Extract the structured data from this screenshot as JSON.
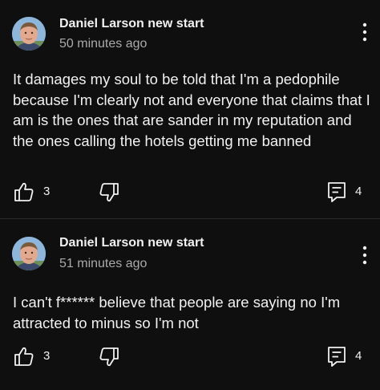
{
  "comments": [
    {
      "author": "Daniel Larson new start",
      "time": "50 minutes ago",
      "text": "It damages my soul to be told that I'm a pedophile because I'm clearly not and everyone that claims that I am is the ones that are sander in my reputation and the ones calling the hotels getting me banned",
      "likes": "3",
      "replies": "4",
      "avatar_icon": "avatar-photo",
      "like_icon": "thumbs-up-icon",
      "dislike_icon": "thumbs-down-icon",
      "reply_icon": "reply-icon",
      "more_icon": "more-vertical-icon"
    },
    {
      "author": "Daniel Larson new start",
      "time": "51 minutes ago",
      "text": "I can't f****** believe that people are saying no I'm attracted to minus so I'm not",
      "likes": "3",
      "replies": "4",
      "avatar_icon": "avatar-photo",
      "like_icon": "thumbs-up-icon",
      "dislike_icon": "thumbs-down-icon",
      "reply_icon": "reply-icon",
      "more_icon": "more-vertical-icon"
    }
  ],
  "colors": {
    "background": "#0f0f0f",
    "text": "#f1f1f1",
    "secondary_text": "#aaaaaa"
  }
}
